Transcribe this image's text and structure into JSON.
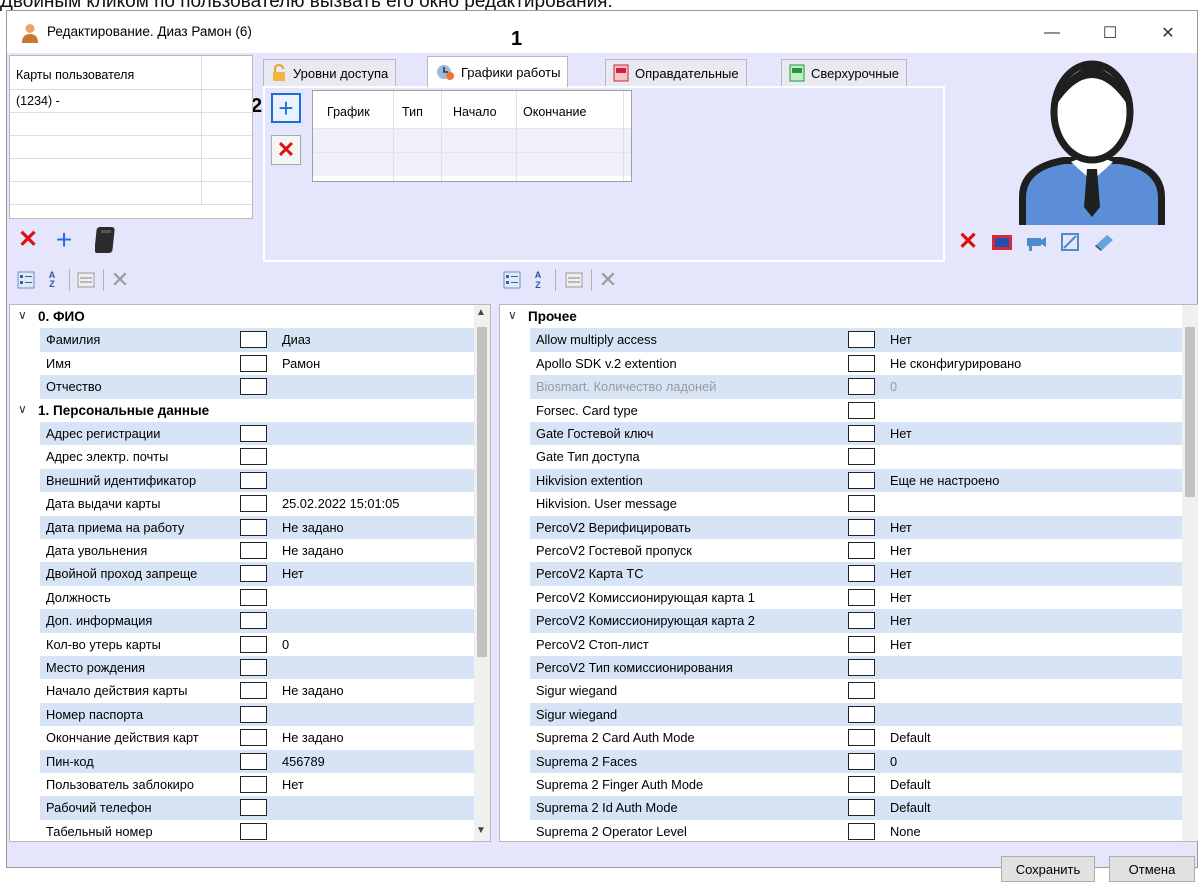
{
  "caption": "Двойным кликом по пользователю вызвать его окно редактирования.",
  "window": {
    "title": "Редактирование. Диаз Рамон (6)",
    "minimize": "—",
    "maximize": "☐",
    "close": "✕"
  },
  "annotations": {
    "one": "1",
    "two": "2"
  },
  "cards": {
    "header": "Карты пользователя",
    "rows": [
      "(1234) -"
    ]
  },
  "tabs": [
    {
      "label": "Уровни доступа",
      "icon": "lock-icon"
    },
    {
      "label": "Графики работы",
      "icon": "schedule-icon",
      "active": true
    },
    {
      "label": "Оправдательные",
      "icon": "document-red-icon"
    },
    {
      "label": "Сверхурочные",
      "icon": "document-green-icon"
    }
  ],
  "schedule_table": {
    "columns": [
      "График",
      "Тип",
      "Начало",
      "Окончание"
    ]
  },
  "left_grid": {
    "rows": [
      {
        "type": "cat",
        "name": "0. ФИО"
      },
      {
        "name": "Фамилия",
        "value": "Диаз"
      },
      {
        "name": "Имя",
        "value": "Рамон"
      },
      {
        "name": "Отчество",
        "value": ""
      },
      {
        "type": "cat",
        "name": "1. Персональные данные"
      },
      {
        "name": "Адрес регистрации",
        "value": ""
      },
      {
        "name": "Адрес электр. почты",
        "value": ""
      },
      {
        "name": "Внешний идентификатор",
        "value": ""
      },
      {
        "name": "Дата выдачи карты",
        "value": "25.02.2022 15:01:05"
      },
      {
        "name": "Дата приема на работу",
        "value": "Не задано"
      },
      {
        "name": "Дата увольнения",
        "value": "Не задано"
      },
      {
        "name": "Двойной проход запреще",
        "value": "Нет"
      },
      {
        "name": "Должность",
        "value": ""
      },
      {
        "name": "Доп. информация",
        "value": ""
      },
      {
        "name": "Кол-во утерь карты",
        "value": "0"
      },
      {
        "name": "Место рождения",
        "value": ""
      },
      {
        "name": "Начало действия карты",
        "value": "Не задано"
      },
      {
        "name": "Номер паспорта",
        "value": ""
      },
      {
        "name": "Окончание действия карт",
        "value": "Не задано"
      },
      {
        "name": "Пин-код",
        "value": "456789"
      },
      {
        "name": "Пользователь заблокиро",
        "value": "Нет"
      },
      {
        "name": "Рабочий телефон",
        "value": ""
      },
      {
        "name": "Табельный номер",
        "value": ""
      }
    ]
  },
  "right_grid": {
    "rows": [
      {
        "type": "cat",
        "name": "Прочее"
      },
      {
        "name": "Allow multiply access",
        "value": "Нет"
      },
      {
        "name": "Apollo SDK v.2 extention",
        "value": "Не сконфигурировано"
      },
      {
        "name": "Biosmart. Количество ладоней",
        "value": "0",
        "disabled": true
      },
      {
        "name": "Forsec. Card type",
        "value": ""
      },
      {
        "name": "Gate Гостевой ключ",
        "value": "Нет"
      },
      {
        "name": "Gate Тип доступа",
        "value": ""
      },
      {
        "name": "Hikvision extention",
        "value": "Еще не настроено"
      },
      {
        "name": "Hikvision. User message",
        "value": ""
      },
      {
        "name": "PercoV2 Верифицировать",
        "value": "Нет"
      },
      {
        "name": "PercoV2 Гостевой пропуск",
        "value": "Нет"
      },
      {
        "name": "PercoV2 Карта ТС",
        "value": "Нет"
      },
      {
        "name": "PercoV2 Комиссионирующая карта 1",
        "value": "Нет"
      },
      {
        "name": "PercoV2 Комиссионирующая карта 2",
        "value": "Нет"
      },
      {
        "name": "PercoV2 Стоп-лист",
        "value": "Нет"
      },
      {
        "name": "PercoV2 Тип комиссионирования",
        "value": ""
      },
      {
        "name": "Sigur wiegand",
        "value": ""
      },
      {
        "name": "Sigur wiegand",
        "value": ""
      },
      {
        "name": "Suprema 2 Card Auth Mode",
        "value": "Default"
      },
      {
        "name": "Suprema 2 Faces",
        "value": "0"
      },
      {
        "name": "Suprema 2 Finger Auth Mode",
        "value": "Default"
      },
      {
        "name": "Suprema 2 Id Auth Mode",
        "value": "Default"
      },
      {
        "name": "Suprema 2 Operator Level",
        "value": "None"
      }
    ]
  },
  "toolbar": {
    "az_label": "A Z"
  },
  "buttons": {
    "save": "Сохранить",
    "cancel": "Отмена"
  },
  "colors": {
    "window_bg": "#e5e5fc",
    "row_bg": "#d6e4f5",
    "accent_blue": "#1d6fd8",
    "delete_red": "#e01010"
  }
}
